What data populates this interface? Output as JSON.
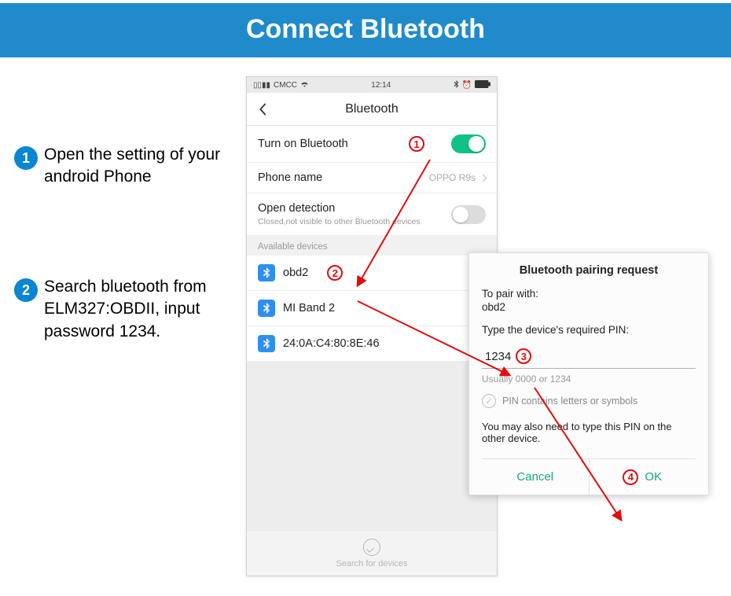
{
  "banner": {
    "title": "Connect Bluetooth"
  },
  "instructions": {
    "step1": {
      "num": "1",
      "text": "Open the setting of your android Phone"
    },
    "step2": {
      "num": "2",
      "text": "Search bluetooth from ELM327:OBDII, input password 1234."
    }
  },
  "markers": {
    "m1": "1",
    "m2": "2",
    "m3": "3",
    "m4": "4"
  },
  "phone": {
    "status": {
      "carrier": "CMCC",
      "time": "12:14"
    },
    "nav": {
      "title": "Bluetooth"
    },
    "rows": {
      "bluetooth_label": "Turn on Bluetooth",
      "phone_name_label": "Phone name",
      "phone_name_value": "OPPO R9s",
      "open_detection_label": "Open detection",
      "open_detection_sub": "Closed,not visible to other Bluetooth devices",
      "available_label": "Available devices"
    },
    "devices": {
      "d1": "obd2",
      "d2": "MI Band 2",
      "d3": "24:0A:C4:80:8E:46"
    },
    "footer": {
      "label": "Search for devices"
    }
  },
  "dialog": {
    "title": "Bluetooth pairing request",
    "to_pair_label": "To pair with:",
    "to_pair_value": "obd2",
    "type_pin_label": "Type the device's required PIN:",
    "pin_value": "1234",
    "hint": "Usually 0000 or 1234",
    "checkbox_label": "PIN contains letters or symbols",
    "note": "You may also need to type this PIN on the other device.",
    "cancel": "Cancel",
    "ok": "OK"
  }
}
